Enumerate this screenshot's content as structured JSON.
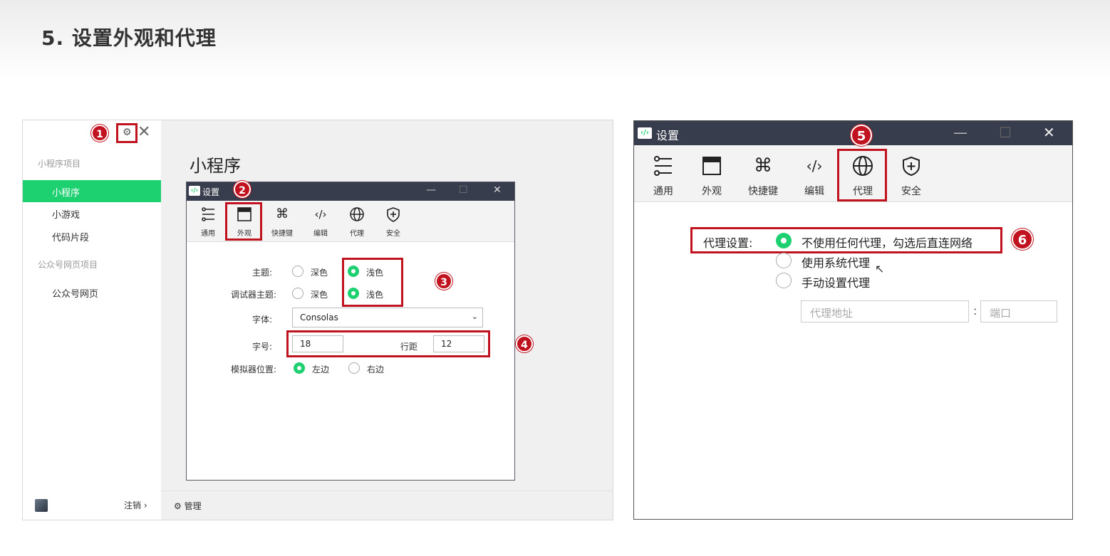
{
  "slide": {
    "title": "5. 设置外观和代理"
  },
  "left_panel": {
    "sidebar": {
      "group1": "小程序项目",
      "items1": [
        "小程序",
        "小游戏",
        "代码片段"
      ],
      "group2": "公众号网页项目",
      "items2": [
        "公众号网页"
      ]
    },
    "main_title": "小程序",
    "footer": {
      "logout": "注销 ›",
      "manage": "管理"
    },
    "badges": [
      "1",
      "2",
      "3",
      "4"
    ],
    "settings_window": {
      "title": "设置",
      "toolbar": [
        "通用",
        "外观",
        "快捷键",
        "编辑",
        "代理",
        "安全"
      ],
      "theme_label": "主题:",
      "debugger_theme_label": "调试器主题:",
      "dark": "深色",
      "light": "浅色",
      "font_label": "字体:",
      "font_value": "Consolas",
      "font_size_label": "字号:",
      "font_size_value": "18",
      "line_height_label": "行距",
      "line_height_value": "12",
      "simulator_label": "模拟器位置:",
      "left": "左边",
      "right": "右边"
    }
  },
  "right_window": {
    "title": "设置",
    "toolbar": [
      "通用",
      "外观",
      "快捷键",
      "编辑",
      "代理",
      "安全"
    ],
    "proxy_label": "代理设置:",
    "options": [
      "不使用任何代理，勾选后直连网络",
      "使用系统代理",
      "手动设置代理"
    ],
    "selected_option": "不使用任何代理，勾选后直连网络",
    "address_placeholder": "代理地址",
    "port_placeholder": "端口",
    "colon": ":",
    "badges": [
      "5",
      "6"
    ]
  },
  "colors": {
    "accent": "#1dd070",
    "titlebar": "#383d4d",
    "highlight": "#c1121f"
  }
}
